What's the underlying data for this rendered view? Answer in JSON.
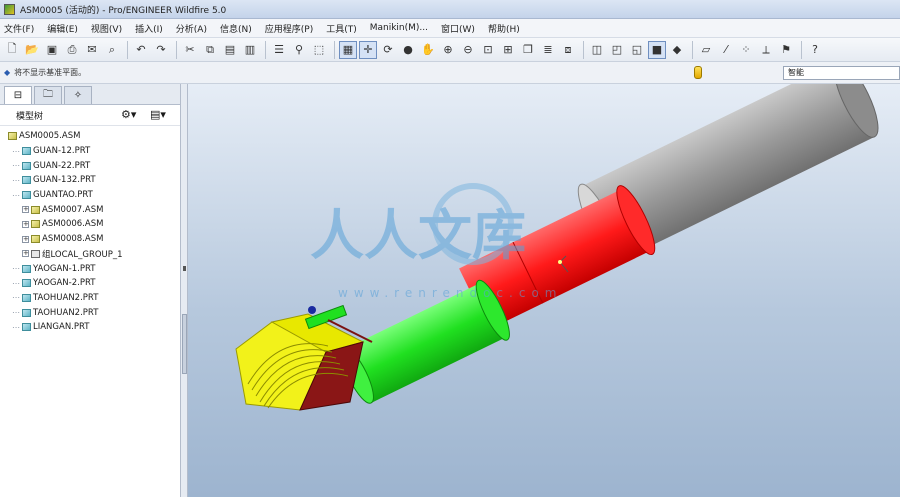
{
  "window": {
    "title": "ASM0005 (活动的) - Pro/ENGINEER Wildfire 5.0"
  },
  "menu": [
    "文件(F)",
    "编辑(E)",
    "视图(V)",
    "插入(I)",
    "分析(A)",
    "信息(N)",
    "应用程序(P)",
    "工具(T)",
    "Manikin(M)...",
    "窗口(W)",
    "帮助(H)"
  ],
  "toolbar": {
    "icons": [
      "new-file-icon",
      "open-folder-icon",
      "save-icon",
      "print-icon",
      "email-icon",
      "zoom-file-icon",
      "undo-icon",
      "redo-icon",
      "cut-icon",
      "copy-icon",
      "paste-icon",
      "paste-special-icon",
      "regenerate-icon",
      "find-icon",
      "select-box-icon",
      "repaint-icon",
      "spin-center-icon",
      "orient-icon",
      "appearance-icon",
      "pan-icon",
      "zoom-in-icon",
      "zoom-out-icon",
      "refit-icon",
      "reorient-icon",
      "saved-views-icon",
      "layers-icon",
      "view-manager-icon",
      "wireframe-icon",
      "hidden-line-icon",
      "no-hidden-icon",
      "shading-icon",
      "enhanced-realism-icon",
      "datum-planes-icon",
      "datum-axes-icon",
      "datum-points-icon",
      "coordinate-systems-icon",
      "context-help-icon"
    ]
  },
  "status": {
    "message": "将不显示基准平面。",
    "filter_value": "智能"
  },
  "model_tree": {
    "tabs": [
      "tab-model-tree",
      "tab-folder-browser",
      "tab-favorites"
    ],
    "header": "模型树",
    "items": [
      {
        "label": "ASM0005.ASM",
        "type": "asm",
        "level": 0,
        "expandable": false
      },
      {
        "label": "GUAN-12.PRT",
        "type": "prt",
        "level": 1,
        "expandable": false
      },
      {
        "label": "GUAN-22.PRT",
        "type": "prt",
        "level": 1,
        "expandable": false
      },
      {
        "label": "GUAN-132.PRT",
        "type": "prt",
        "level": 1,
        "expandable": false
      },
      {
        "label": "GUANTAO.PRT",
        "type": "prt",
        "level": 1,
        "expandable": false
      },
      {
        "label": "ASM0007.ASM",
        "type": "asm",
        "level": 1,
        "expandable": true
      },
      {
        "label": "ASM0006.ASM",
        "type": "asm",
        "level": 1,
        "expandable": true
      },
      {
        "label": "ASM0008.ASM",
        "type": "asm",
        "level": 1,
        "expandable": true
      },
      {
        "label": "组LOCAL_GROUP_1",
        "type": "grp",
        "level": 1,
        "expandable": true
      },
      {
        "label": "YAOGAN-1.PRT",
        "type": "prt",
        "level": 1,
        "expandable": false
      },
      {
        "label": "YAOGAN-2.PRT",
        "type": "prt",
        "level": 1,
        "expandable": false
      },
      {
        "label": "TAOHUAN2.PRT",
        "type": "prt",
        "level": 1,
        "expandable": false
      },
      {
        "label": "TAOHUAN2.PRT",
        "type": "prt",
        "level": 1,
        "expandable": false
      },
      {
        "label": "LIANGAN.PRT",
        "type": "prt",
        "level": 1,
        "expandable": false
      }
    ]
  },
  "watermark": {
    "logo_text": "人人文库",
    "url_text": "www.renrendoc.com"
  },
  "colors": {
    "accent": "#2a5db0",
    "cylinder_gray": "#9a9a9a",
    "cylinder_red": "#ff1a1a",
    "cylinder_green": "#20e020",
    "bucket_yellow": "#f2f21a",
    "bucket_maroon": "#8a1616"
  }
}
